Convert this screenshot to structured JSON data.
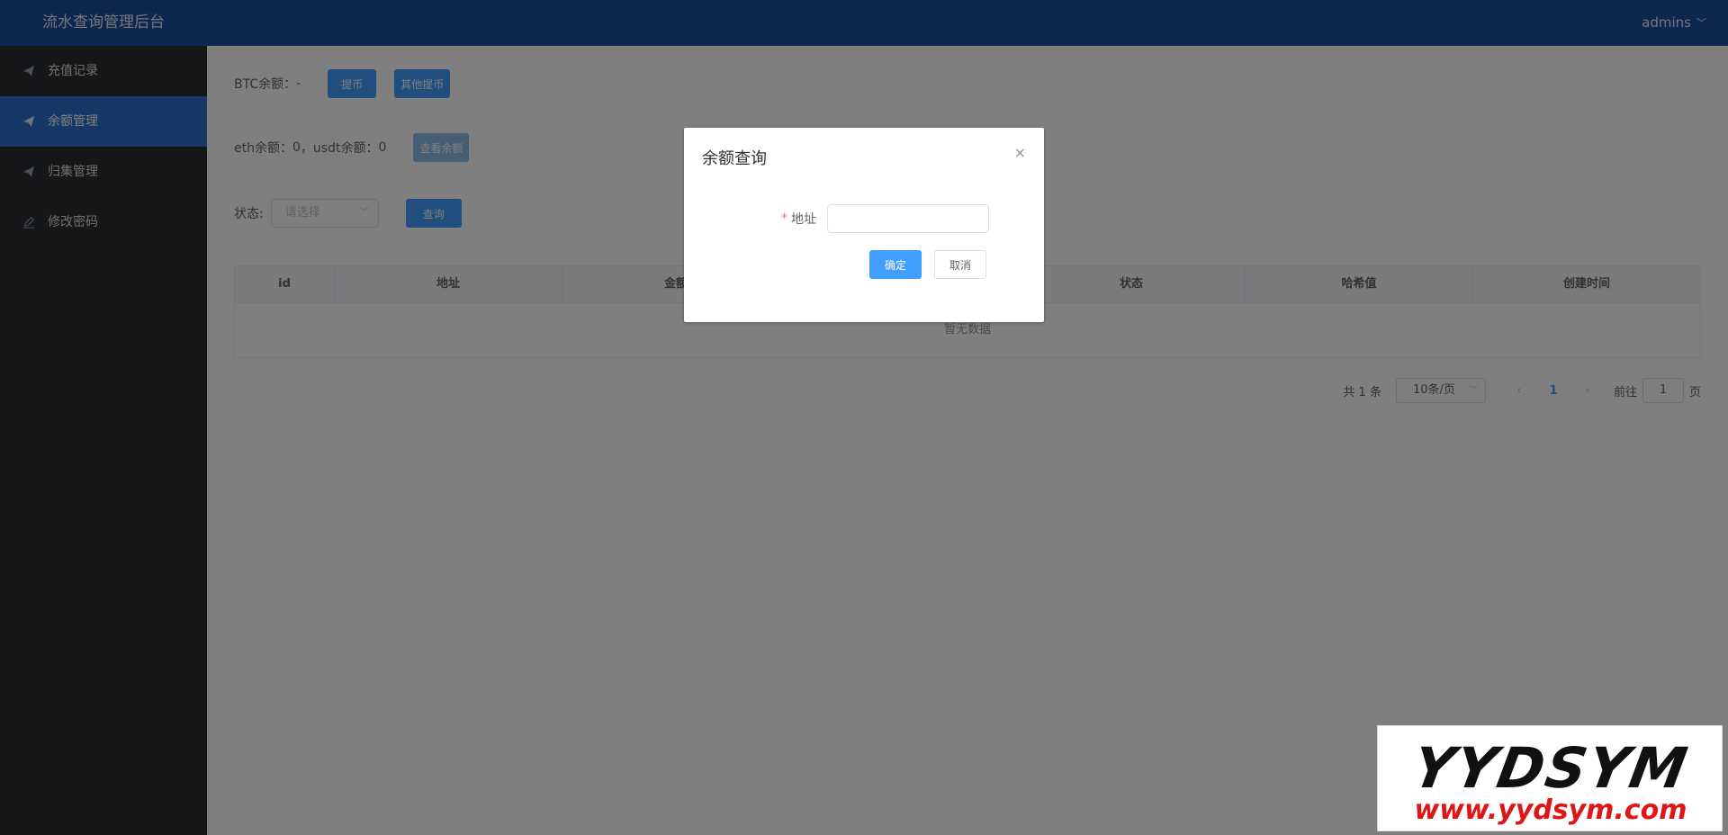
{
  "header": {
    "title": "流水查询管理后台",
    "user": "admins",
    "user_chevron": "﹀"
  },
  "sidebar": {
    "items": [
      {
        "label": "充值记录",
        "icon": "paper-plane-icon",
        "active": false
      },
      {
        "label": "余额管理",
        "icon": "paper-plane-icon",
        "active": true
      },
      {
        "label": "归集管理",
        "icon": "paper-plane-icon",
        "active": false
      },
      {
        "label": "修改密码",
        "icon": "edit-icon",
        "active": false
      }
    ]
  },
  "main": {
    "btc_label": "BTC余额：",
    "btc_value": "-",
    "withdraw_btn": "提币",
    "other_withdraw_btn": "其他提币",
    "eth_label": "eth余额：",
    "eth_value": "0",
    "sep": "，",
    "usdt_label": "usdt余额：",
    "usdt_value": "0",
    "check_balance_btn": "查看余额",
    "status_label": "状态:",
    "status_placeholder": "请选择",
    "query_btn": "查询",
    "table": {
      "headers": [
        "id",
        "地址",
        "金额",
        "",
        "状态",
        "哈希值",
        "创建时间"
      ],
      "empty_text": "暂无数据"
    },
    "pagination": {
      "total": "共 1 条",
      "page_size": "10条/页",
      "prev": "‹",
      "current": "1",
      "next": "›",
      "goto_label": "前往",
      "goto_value": "1",
      "page_suffix": "页"
    }
  },
  "dialog": {
    "title": "余额查询",
    "close_symbol": "×",
    "required_mark": "*",
    "address_label": "地址",
    "address_value": "",
    "confirm_btn": "确定",
    "cancel_btn": "取消"
  },
  "watermark": {
    "brand": "YYDSYM",
    "url": "www.yydsym.com"
  },
  "colors": {
    "header_bg": "#1d4f9c",
    "sidebar_bg": "#2b2f33",
    "active_menu": "#2f6fcf",
    "primary": "#409eff"
  }
}
